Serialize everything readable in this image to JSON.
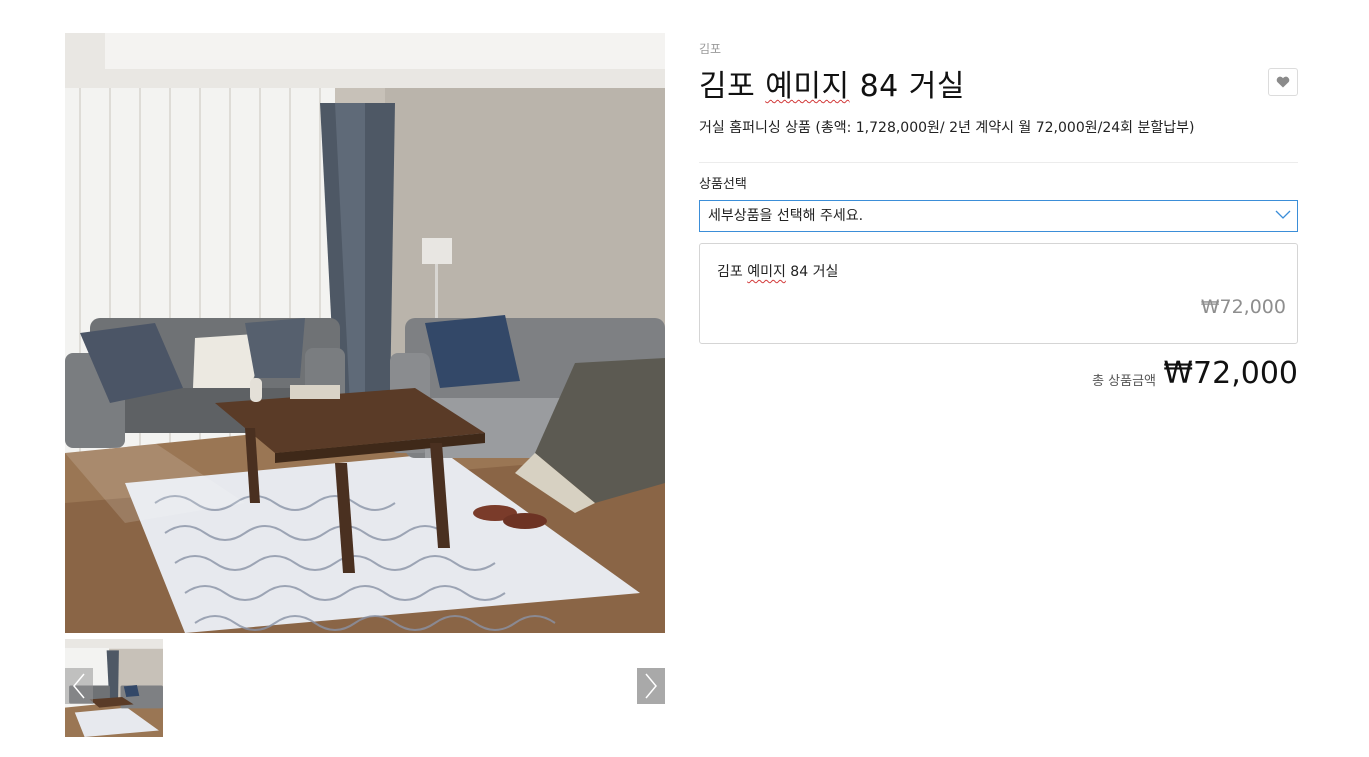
{
  "gallery": {
    "main_image_alt": "",
    "prev_icon": "chevron-left-icon",
    "next_icon": "chevron-right-icon"
  },
  "product": {
    "region": "김포",
    "title": "김포 예미지 84 거실",
    "title_parts": [
      "김포 ",
      "예미지",
      " 84 거실"
    ],
    "description": "거실 홈퍼니싱 상품 (총액: 1,728,000원/ 2년 계약시 월 72,000원/24회 분할납부)",
    "wish_icon": "heart-icon"
  },
  "options": {
    "label": "상품선택",
    "select_placeholder": "세부상품을 선택해 주세요.",
    "selected_item": {
      "name_parts": [
        "김포 ",
        "예미지",
        " 84 거실"
      ],
      "price": "₩72,000"
    }
  },
  "total": {
    "label": "총 상품금액",
    "price": "₩72,000"
  },
  "colors": {
    "accent_border": "#3b8ed8",
    "muted_text": "#8e8e8e"
  }
}
